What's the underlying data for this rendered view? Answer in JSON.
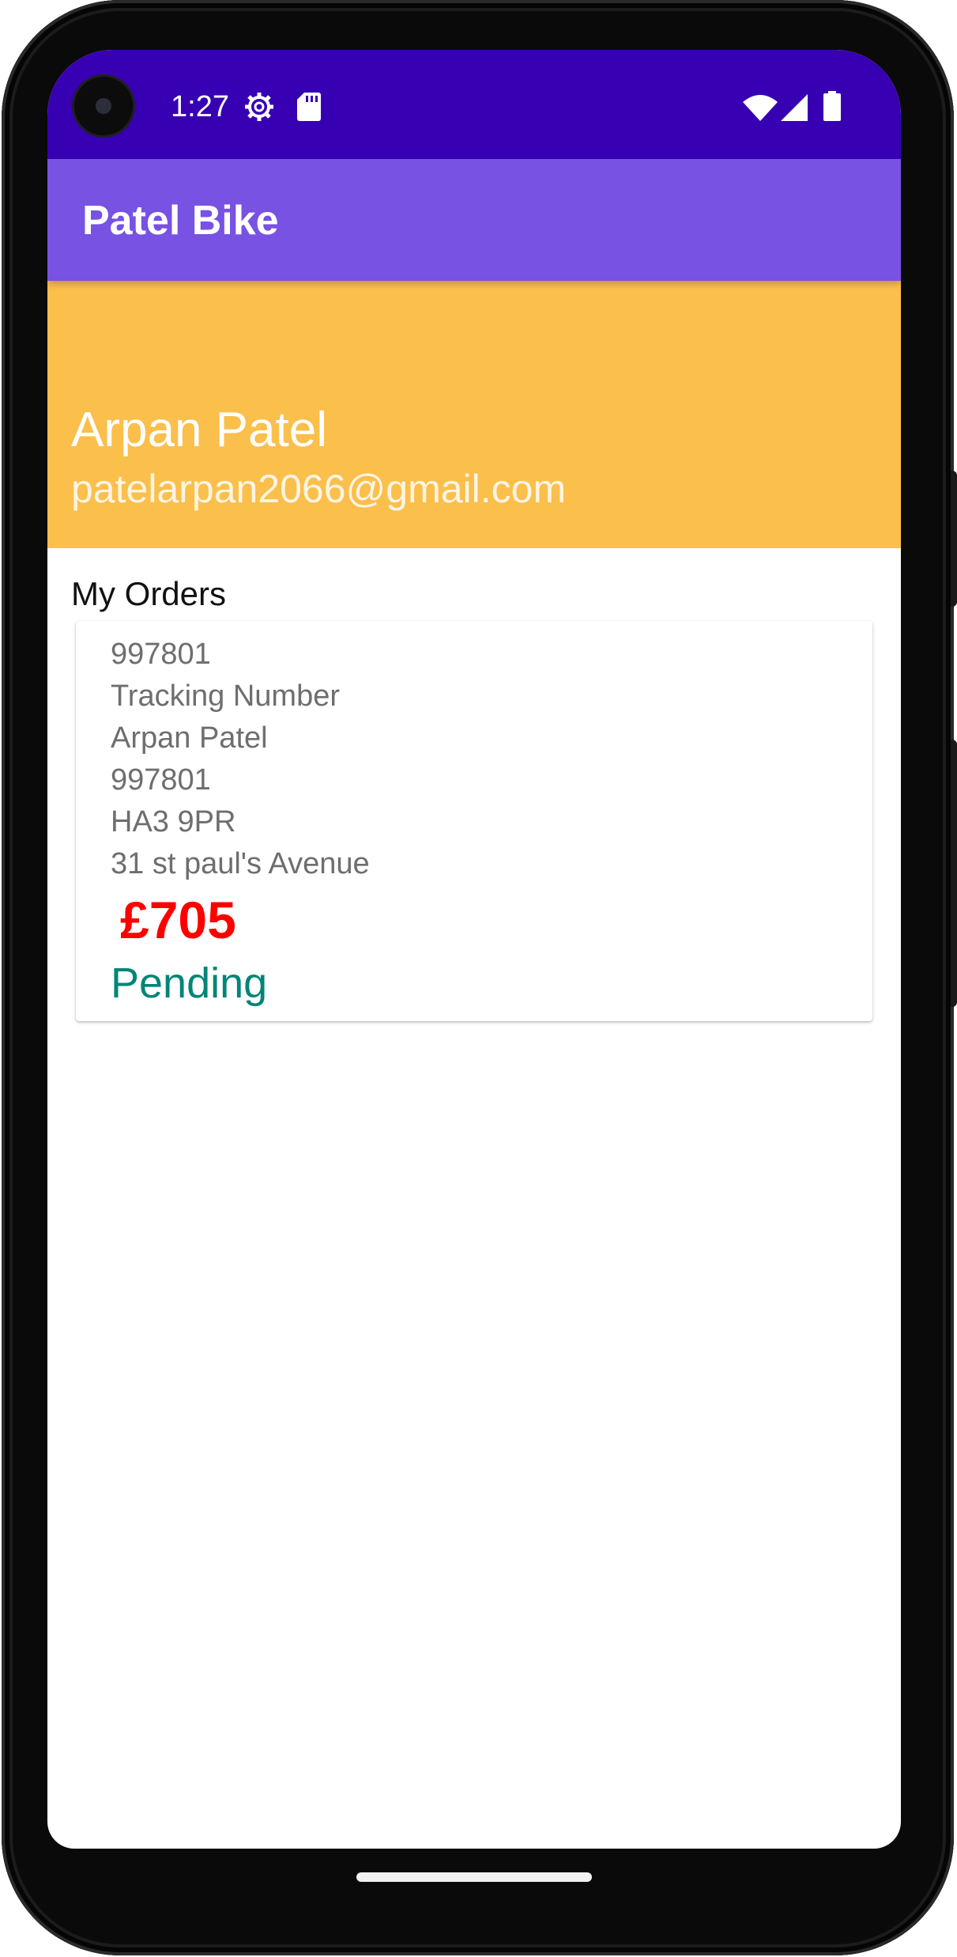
{
  "status_bar": {
    "time": "1:27",
    "icons": [
      "settings-icon",
      "sd-card-icon",
      "wifi-icon",
      "cell-signal-icon",
      "battery-icon"
    ]
  },
  "app_bar": {
    "title": "Patel Bike"
  },
  "profile": {
    "name": "Arpan Patel",
    "email": "patelarpan2066@gmail.com"
  },
  "orders": {
    "heading": "My Orders",
    "items": [
      {
        "order_id": "997801",
        "tracking_label": "Tracking Number",
        "customer_name": "Arpan Patel",
        "tracking_number": "997801",
        "postcode": "HA3 9PR",
        "address": "31 st paul's Avenue",
        "price": "£705",
        "status": "Pending"
      }
    ]
  },
  "colors": {
    "status_bar": "#3700b3",
    "app_bar": "#7752e3",
    "profile_background": "#fbbf4c",
    "price": "#ff0000",
    "status": "#008577"
  }
}
